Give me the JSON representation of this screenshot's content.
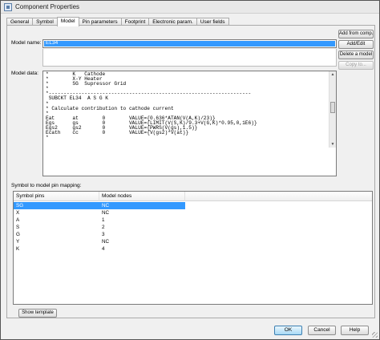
{
  "window": {
    "title": "Component Properties"
  },
  "tabs": [
    {
      "label": "General",
      "active": false
    },
    {
      "label": "Symbol",
      "active": false
    },
    {
      "label": "Model",
      "active": true
    },
    {
      "label": "Pin parameters",
      "active": false
    },
    {
      "label": "Footprint",
      "active": false
    },
    {
      "label": "Electronic param.",
      "active": false
    },
    {
      "label": "User fields",
      "active": false
    }
  ],
  "model_name": {
    "label": "Model name:",
    "value": "EL34"
  },
  "model_data": {
    "label": "Model data:",
    "lines": [
      "*        K   Cathode",
      "*        X-Y Heater",
      "*        SG  Supressor Grid",
      "*",
      "*--------------------------------------------------------------------",
      " SUBCKT EL34  A S G K",
      "*",
      "* Calculate contribution to cathode current",
      "*",
      "Eat      at        0        VALUE={0.636*ATAN(V(A,K)/23)}",
      "Egs      gs        0        VALUE={LIMIT(V(S,K)/9.3+V(G,K)*0.95,0,1E6)}",
      "Egs2     gs2       0        VALUE={PWRS(V(gs),1.5)}",
      "Ecath    cc        0        VALUE={V(gs2)*V(at)}",
      "*"
    ]
  },
  "side_buttons": {
    "add_from_comp": "Add from comp.",
    "add_edit": "Add/Edit",
    "delete_model": "Delete a model",
    "copy_to": "Copy to..."
  },
  "mapping": {
    "label": "Symbol to model pin mapping:",
    "columns": [
      "Symbol pins",
      "Model nodes"
    ],
    "rows": [
      {
        "pin": "SG",
        "node": "NC"
      },
      {
        "pin": "X",
        "node": "NC"
      },
      {
        "pin": "A",
        "node": "1"
      },
      {
        "pin": "S",
        "node": "2"
      },
      {
        "pin": "G",
        "node": "3"
      },
      {
        "pin": "Y",
        "node": "NC"
      },
      {
        "pin": "K",
        "node": "4"
      }
    ],
    "selected_row": 0
  },
  "buttons": {
    "show_template": "Show template",
    "ok": "OK",
    "cancel": "Cancel",
    "help": "Help"
  },
  "colors": {
    "selection": "#3399ff",
    "ok_button": "#a7d9f5"
  }
}
